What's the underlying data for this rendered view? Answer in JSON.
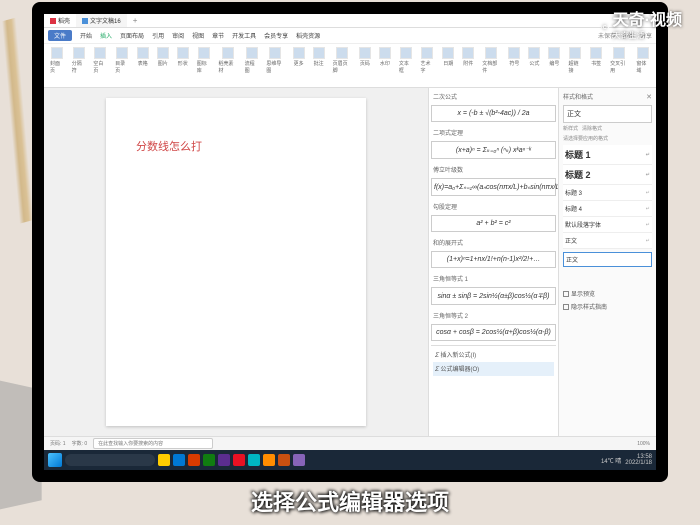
{
  "watermark": {
    "brand": "天奇·视频",
    "sub": "天奇生活"
  },
  "caption": "选择公式编辑器选项",
  "tabs": [
    {
      "label": "稻壳"
    },
    {
      "label": "文字文稿16"
    }
  ],
  "menu": {
    "start": "文件",
    "items": [
      "开始",
      "插入",
      "页面布局",
      "引用",
      "审阅",
      "视图",
      "章节",
      "开发工具",
      "会员专享",
      "稻壳资源"
    ],
    "right": [
      "未保存",
      "协作",
      "分享"
    ]
  },
  "ribbon": [
    "封面页",
    "分隔符",
    "空白页",
    "目录页",
    "表格",
    "图片",
    "形状",
    "图标库",
    "稻壳素材",
    "流程图",
    "思维导图",
    "更多",
    "批注",
    "页眉页脚",
    "页码",
    "水印",
    "文本框",
    "艺术字",
    "日期",
    "附件",
    "文档部件",
    "符号",
    "公式",
    "编号",
    "超链接",
    "书签",
    "交叉引用",
    "窗体域"
  ],
  "doc": {
    "text": "分数线怎么打"
  },
  "formulas": {
    "sections": [
      {
        "title": "二次公式",
        "expr": "x = (-b ± √(b²-4ac)) / 2a"
      },
      {
        "title": "二项式定理",
        "expr": "(x+a)ⁿ = Σₖ₌₀ⁿ (ⁿₖ) xᵏaⁿ⁻ᵏ"
      },
      {
        "title": "傅立叶级数",
        "expr": "f(x)=a₀+Σₙ₌₁∞(aₙcos(nπx/L)+bₙsin(nπx/L))"
      },
      {
        "title": "勾股定理",
        "expr": "a² + b² = c²"
      },
      {
        "title": "和的展开式",
        "expr": "(1+x)ⁿ=1+nx/1!+n(n-1)x²/2!+…"
      },
      {
        "title": "三角恒等式 1",
        "expr": "sinα ± sinβ = 2sin½(α±β)cos½(α∓β)"
      },
      {
        "title": "三角恒等式 2",
        "expr": "cosα + cosβ = 2cos½(α+β)cos½(α-β)"
      }
    ],
    "actions": {
      "insert": "插入新公式(I)",
      "editor": "公式编辑器(O)"
    }
  },
  "styles": {
    "title": "样式和格式",
    "tabs": [
      "新样式",
      "清除格式"
    ],
    "current": "正文",
    "listhdr": "请选择要应用的格式",
    "items": [
      {
        "n": "标题 1",
        "h": true
      },
      {
        "n": "标题 2",
        "h": true
      },
      {
        "n": "标题 3",
        "h": false
      },
      {
        "n": "标题 4",
        "h": false
      },
      {
        "n": "默认段落字体",
        "h": false
      },
      {
        "n": "正文",
        "h": false
      }
    ],
    "opts": [
      "显示预览",
      "隐示样式指南"
    ]
  },
  "status": {
    "page": "页码: 1",
    "words": "字数: 0",
    "search_ph": "在此查找输入你要搜索的内容",
    "zoom": "100%"
  },
  "taskbar": {
    "weather": "14℃ 晴",
    "time": "13:58",
    "date": "2022/1/18"
  }
}
